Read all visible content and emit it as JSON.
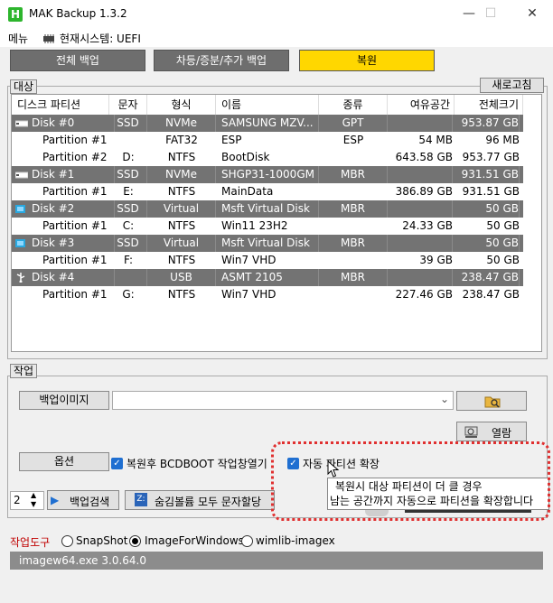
{
  "app": {
    "title": "MAK Backup 1.3.2",
    "icon_letter": "H"
  },
  "window_controls": {
    "minimize": "—",
    "maximize": "☐",
    "close": "✕"
  },
  "menu": {
    "menu_label": "메뉴",
    "system_label": "현재시스템: UEFI"
  },
  "modes": [
    {
      "label": "전체 백업"
    },
    {
      "label": "차등/증분/추가 백업"
    },
    {
      "label": "복원"
    }
  ],
  "target": {
    "group_label": "대상",
    "refresh_label": "새로고침",
    "columns": [
      "디스크 파티션",
      "문자",
      "형식",
      "이름",
      "종류",
      "여유공간",
      "전체크기"
    ],
    "rows": [
      {
        "kind": "disk",
        "icon": "hdd-icon",
        "name": "Disk #0",
        "char": "SSD",
        "type": "NVMe",
        "label": "SAMSUNG MZV...",
        "fs": "GPT",
        "free": "",
        "total": "953.87 GB"
      },
      {
        "kind": "part",
        "name": "Partition #1",
        "char": "",
        "type": "FAT32",
        "label": "ESP",
        "fs": "ESP",
        "free": "54 MB",
        "total": "96 MB"
      },
      {
        "kind": "part",
        "name": "Partition #2",
        "char": "D:",
        "type": "NTFS",
        "label": "BootDisk",
        "fs": "",
        "free": "643.58 GB",
        "total": "953.77 GB"
      },
      {
        "kind": "disk",
        "icon": "hdd-icon",
        "name": "Disk #1",
        "char": "SSD",
        "type": "NVMe",
        "label": "SHGP31-1000GM",
        "fs": "MBR",
        "free": "",
        "total": "931.51 GB"
      },
      {
        "kind": "part",
        "name": "Partition #1",
        "char": "E:",
        "type": "NTFS",
        "label": "MainData",
        "fs": "",
        "free": "386.89 GB",
        "total": "931.51 GB"
      },
      {
        "kind": "disk",
        "icon": "virtual-disk-icon",
        "name": "Disk #2",
        "char": "SSD",
        "type": "Virtual",
        "label": "Msft Virtual Disk",
        "fs": "MBR",
        "free": "",
        "total": "50 GB"
      },
      {
        "kind": "part",
        "name": "Partition #1",
        "char": "C:",
        "type": "NTFS",
        "label": "Win11 23H2",
        "fs": "",
        "free": "24.33 GB",
        "total": "50 GB"
      },
      {
        "kind": "disk",
        "icon": "virtual-disk-icon",
        "name": "Disk #3",
        "char": "SSD",
        "type": "Virtual",
        "label": "Msft Virtual Disk",
        "fs": "MBR",
        "free": "",
        "total": "50 GB"
      },
      {
        "kind": "part",
        "name": "Partition #1",
        "char": "F:",
        "type": "NTFS",
        "label": "Win7 VHD",
        "fs": "",
        "free": "39 GB",
        "total": "50 GB"
      },
      {
        "kind": "disk",
        "icon": "usb-icon",
        "name": "Disk #4",
        "char": "",
        "type": "USB",
        "label": "ASMT 2105",
        "fs": "MBR",
        "free": "",
        "total": "238.47 GB"
      },
      {
        "kind": "part",
        "name": "Partition #1",
        "char": "G:",
        "type": "NTFS",
        "label": "Win7 VHD",
        "fs": "",
        "free": "227.46 GB",
        "total": "238.47 GB"
      }
    ]
  },
  "task": {
    "group_label": "작업",
    "backup_image_label": "백업이미지",
    "image_path": "",
    "open_label": "열람",
    "options_label": "옵션",
    "bcdboot_label": "복원후 BCDBOOT 작업창열기",
    "auto_partition_label": "자동 파티션 확장",
    "spinner_value": "2",
    "backup_search_label": "백업검색",
    "hidden_volume_label": "숨김볼륨 모두 문자할당",
    "tooltip_line1": "복원시 대상 파티션이 더 클 경우",
    "tooltip_line2": "남는 공간까지 자동으로 파티션을 확장합니다"
  },
  "tools": {
    "label": "작업도구",
    "options": [
      "SnapShot",
      "ImageForWindows",
      "wimlib-imagex"
    ],
    "selected": "ImageForWindows"
  },
  "status": {
    "text": "imagew64.exe 3.0.64.0"
  },
  "colors": {
    "restore_accent": "#ffd700",
    "disk_row": "#737373",
    "annotation": "#e03030",
    "tools_label": "#c00000"
  }
}
